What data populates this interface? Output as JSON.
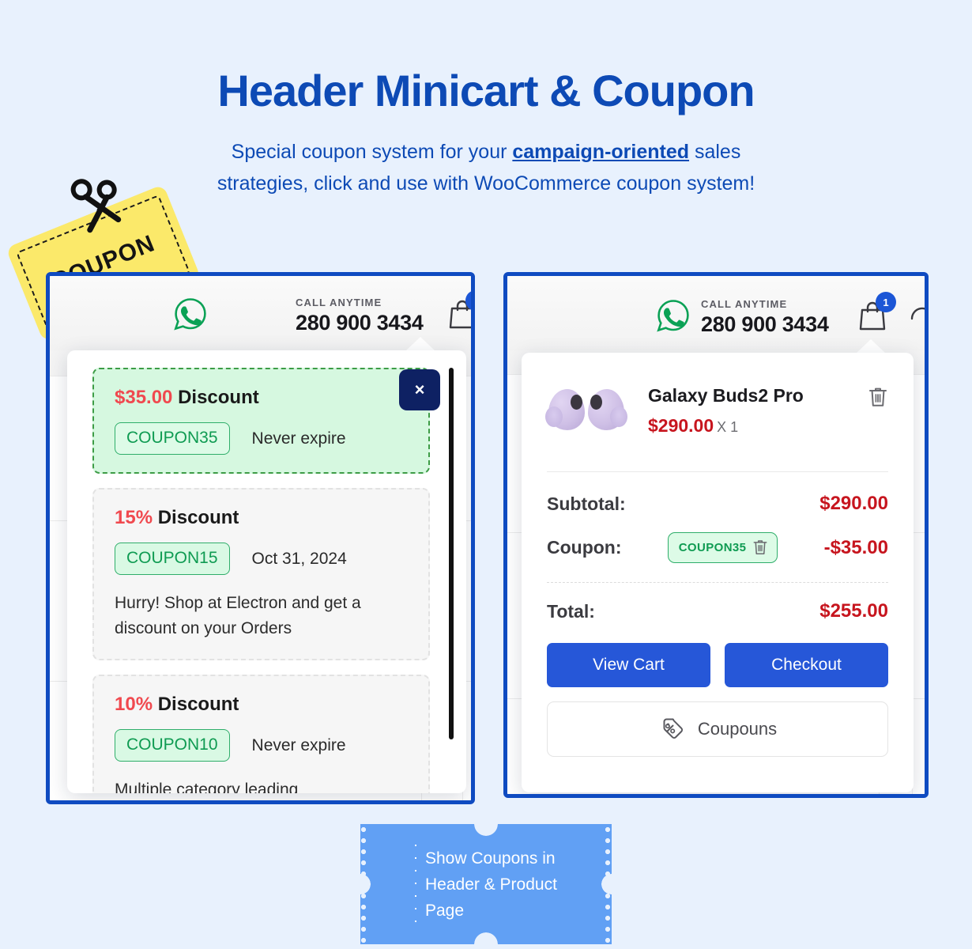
{
  "heading": {
    "title": "Header Minicart & Coupon",
    "subtitle_pre": "Special coupon system for your ",
    "subtitle_strong": "campaign-oriented",
    "subtitle_post": " sales",
    "subtitle_line2": "strategies, click and use with WooCommerce coupon system!"
  },
  "coupon_tag": {
    "label": "COUPON",
    "color": "#fbe96a",
    "icon": "scissors-icon"
  },
  "store_header": {
    "whatsapp_icon": "whatsapp-icon",
    "call_label": "CALL ANYTIME",
    "phone": "280 900 3434",
    "cart_icon": "shopping-bag-icon",
    "cart_count": "1",
    "compare_icon": "compare-icon"
  },
  "left_panel": {
    "close_label": "×",
    "coupons": [
      {
        "amount": "$35.00",
        "discount_label": "Discount",
        "code": "COUPON35",
        "expiry": "Never expire",
        "description": "",
        "active": true
      },
      {
        "amount": "15%",
        "discount_label": "Discount",
        "code": "COUPON15",
        "expiry": "Oct 31, 2024",
        "description": "Hurry! Shop at Electron and get a discount on your Orders",
        "active": false
      },
      {
        "amount": "10%",
        "discount_label": "Discount",
        "code": "COUPON10",
        "expiry": "Never expire",
        "description": "Multiple category leading",
        "active": false
      }
    ]
  },
  "right_panel": {
    "item": {
      "name": "Galaxy Buds2 Pro",
      "price": "$290.00",
      "qty": "X 1",
      "remove_icon": "trash-icon",
      "image": "galaxy-buds-image"
    },
    "totals": {
      "subtotal_label": "Subtotal:",
      "subtotal_value": "$290.00",
      "coupon_label": "Coupon:",
      "coupon_code": "COUPON35",
      "coupon_remove_icon": "trash-icon",
      "coupon_value": "-$35.00",
      "total_label": "Total:",
      "total_value": "$255.00"
    },
    "actions": {
      "view_cart": "View Cart",
      "checkout": "Checkout",
      "coupons": "Coupouns",
      "coupons_icon": "percent-tag-icon"
    }
  },
  "ticket": {
    "line1": "Show Coupons in",
    "line2": "Header & Product Page",
    "color": "#61a0f4"
  },
  "colors": {
    "background": "#e8f1fd",
    "brand_blue": "#0d4ab5",
    "panel_border": "#0f4bc1",
    "button_blue": "#2657d8",
    "accent_red": "#c7151e",
    "discount_red": "#f0494f",
    "coupon_green": "#0f9b52",
    "navy": "#0e2163"
  }
}
